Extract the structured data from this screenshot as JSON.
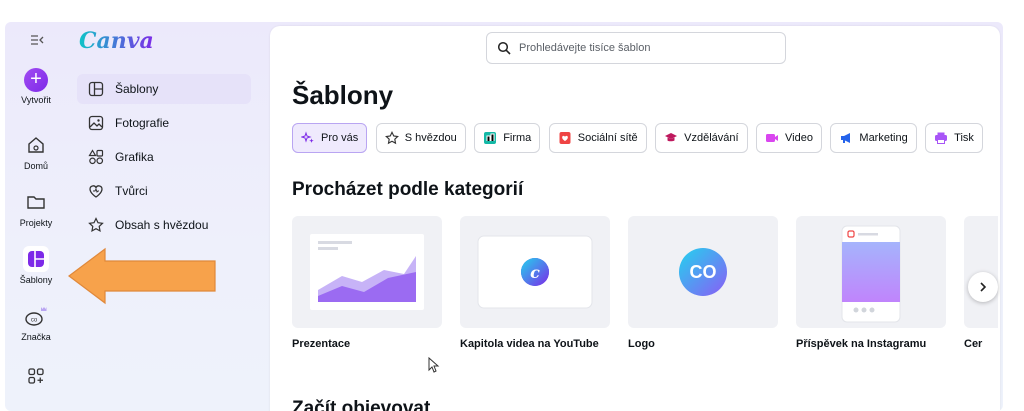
{
  "rail": {
    "create_label": "Vytvořit",
    "items": [
      {
        "label": "Domů"
      },
      {
        "label": "Projekty"
      },
      {
        "label": "Šablony"
      },
      {
        "label": "Značka"
      }
    ]
  },
  "side": {
    "logo": "Canva",
    "items": [
      {
        "label": "Šablony"
      },
      {
        "label": "Fotografie"
      },
      {
        "label": "Grafika"
      },
      {
        "label": "Tvůrci"
      },
      {
        "label": "Obsah s hvězdou"
      }
    ]
  },
  "search": {
    "placeholder": "Prohledávejte tisíce šablon"
  },
  "main": {
    "title": "Šablony",
    "chips": [
      {
        "label": "Pro vás"
      },
      {
        "label": "S hvězdou"
      },
      {
        "label": "Firma"
      },
      {
        "label": "Sociální sítě"
      },
      {
        "label": "Vzdělávání"
      },
      {
        "label": "Video"
      },
      {
        "label": "Marketing"
      },
      {
        "label": "Tisk"
      }
    ],
    "section_title": "Procházet podle kategorií",
    "cards": [
      {
        "label": "Prezentace"
      },
      {
        "label": "Kapitola videa na YouTube"
      },
      {
        "label": "Logo"
      },
      {
        "label": "Příspěvek na Instagramu"
      },
      {
        "label": "Cer"
      }
    ],
    "logo_card_text": "CO",
    "section2_title": "Začít objevovat"
  },
  "colors": {
    "accent": "#7d2ae8",
    "arrow": "#f7a24b",
    "teal": "#00c4cc"
  }
}
